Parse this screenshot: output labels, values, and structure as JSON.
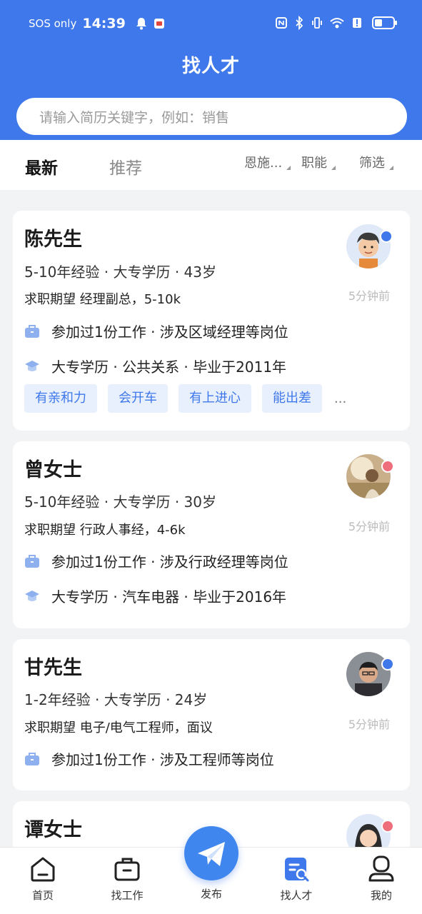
{
  "status_bar": {
    "carrier": "SOS only",
    "time": "14:39"
  },
  "header": {
    "title": "找人才",
    "search_placeholder": "请输入简历关键字，例如：销售"
  },
  "tabs": {
    "latest": "最新",
    "recommend": "推荐",
    "filters": [
      "恩施...",
      "职能",
      "筛选"
    ]
  },
  "cards": [
    {
      "name": "陈先生",
      "meta": "5-10年经验 · 大专学历 · 43岁",
      "expectation": "求职期望 经理副总，5-10k",
      "time": "5分钟前",
      "work": "参加过1份工作 · 涉及区域经理等岗位",
      "edu": "大专学历 · 公共关系 · 毕业于2011年",
      "tags": [
        "有亲和力",
        "会开车",
        "有上进心",
        "能出差"
      ],
      "more": "..."
    },
    {
      "name": "曾女士",
      "meta": "5-10年经验 · 大专学历 · 30岁",
      "expectation": "求职期望 行政人事经，4-6k",
      "time": "5分钟前",
      "work": "参加过1份工作 · 涉及行政经理等岗位",
      "edu": "大专学历 · 汽车电器 · 毕业于2016年"
    },
    {
      "name": "甘先生",
      "meta": "1-2年经验 · 大专学历 · 24岁",
      "expectation": "求职期望 电子/电气工程师，面议",
      "time": "5分钟前",
      "work": "参加过1份工作 · 涉及工程师等岗位"
    },
    {
      "name": "谭女士"
    }
  ],
  "bottom_nav": {
    "home": "首页",
    "find_job": "找工作",
    "publish": "发布",
    "find_talent": "找人才",
    "mine": "我的"
  },
  "colors": {
    "primary": "#3f78ea",
    "tag_bg": "#e8f0fe",
    "male_badge": "#3f78ea",
    "female_badge": "#ef6e7c"
  }
}
